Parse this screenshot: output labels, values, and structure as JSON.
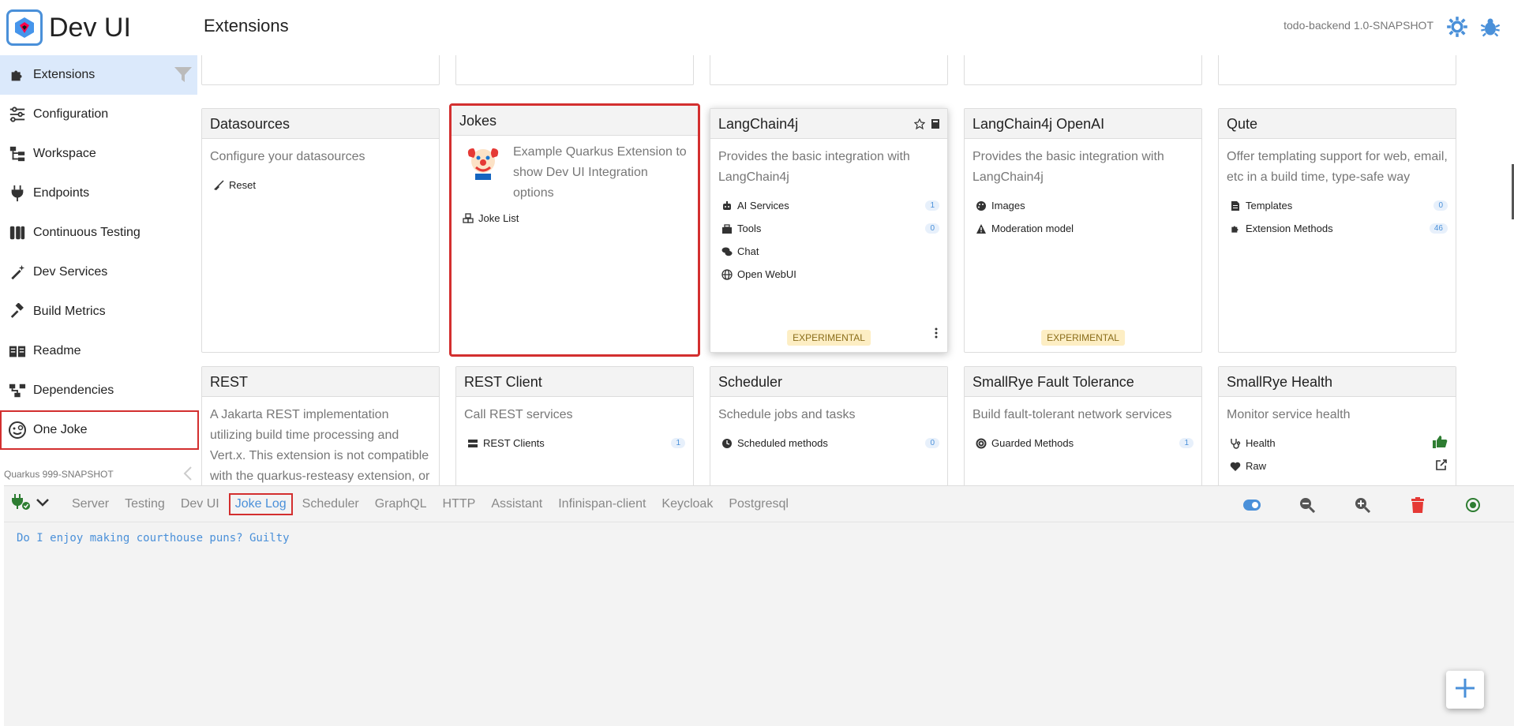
{
  "header": {
    "app_title": "Dev UI",
    "page_title": "Extensions",
    "app_version": "todo-backend 1.0-SNAPSHOT"
  },
  "sidebar": {
    "items": [
      {
        "label": "Extensions"
      },
      {
        "label": "Configuration"
      },
      {
        "label": "Workspace"
      },
      {
        "label": "Endpoints"
      },
      {
        "label": "Continuous Testing"
      },
      {
        "label": "Dev Services"
      },
      {
        "label": "Build Metrics"
      },
      {
        "label": "Readme"
      },
      {
        "label": "Dependencies"
      },
      {
        "label": "One Joke"
      }
    ],
    "footer_version": "Quarkus 999-SNAPSHOT"
  },
  "cards": {
    "datasources": {
      "title": "Datasources",
      "desc": "Configure your datasources",
      "links": [
        {
          "label": "Reset"
        }
      ]
    },
    "jokes": {
      "title": "Jokes",
      "desc": "Example Quarkus Extension to show Dev UI Integration options",
      "links": [
        {
          "label": "Joke List"
        }
      ]
    },
    "langchain4j": {
      "title": "LangChain4j",
      "desc": "Provides the basic integration with LangChain4j",
      "links": [
        {
          "label": "AI Services",
          "count": "1"
        },
        {
          "label": "Tools",
          "count": "0"
        },
        {
          "label": "Chat"
        },
        {
          "label": "Open WebUI"
        }
      ],
      "badge": "EXPERIMENTAL"
    },
    "langchain4j_openai": {
      "title": "LangChain4j OpenAI",
      "desc": "Provides the basic integration with LangChain4j",
      "links": [
        {
          "label": "Images"
        },
        {
          "label": "Moderation model"
        }
      ],
      "badge": "EXPERIMENTAL"
    },
    "qute": {
      "title": "Qute",
      "desc": "Offer templating support for web, email, etc in a build time, type-safe way",
      "links": [
        {
          "label": "Templates",
          "count": "0"
        },
        {
          "label": "Extension Methods",
          "count": "46"
        }
      ]
    },
    "rest": {
      "title": "REST",
      "desc": "A Jakarta REST implementation utilizing build time processing and Vert.x. This extension is not compatible with the quarkus-resteasy extension, or"
    },
    "rest_client": {
      "title": "REST Client",
      "desc": "Call REST services",
      "links": [
        {
          "label": "REST Clients",
          "count": "1"
        }
      ]
    },
    "scheduler": {
      "title": "Scheduler",
      "desc": "Schedule jobs and tasks",
      "links": [
        {
          "label": "Scheduled methods",
          "count": "0"
        }
      ]
    },
    "fault_tolerance": {
      "title": "SmallRye Fault Tolerance",
      "desc": "Build fault-tolerant network services",
      "links": [
        {
          "label": "Guarded Methods",
          "count": "1"
        }
      ]
    },
    "health": {
      "title": "SmallRye Health",
      "desc": "Monitor service health",
      "links": [
        {
          "label": "Health"
        },
        {
          "label": "Raw"
        }
      ]
    }
  },
  "drawer": {
    "tabs": [
      "Server",
      "Testing",
      "Dev UI",
      "Joke Log",
      "Scheduler",
      "GraphQL",
      "HTTP",
      "Assistant",
      "Infinispan-client",
      "Keycloak",
      "Postgresql"
    ],
    "active_tab": "Joke Log",
    "log_line": "Do I enjoy making courthouse puns? Guilty"
  },
  "colors": {
    "accent": "#4a90d9",
    "highlight": "#d32f2f",
    "badge_bg": "#fdeec4"
  }
}
